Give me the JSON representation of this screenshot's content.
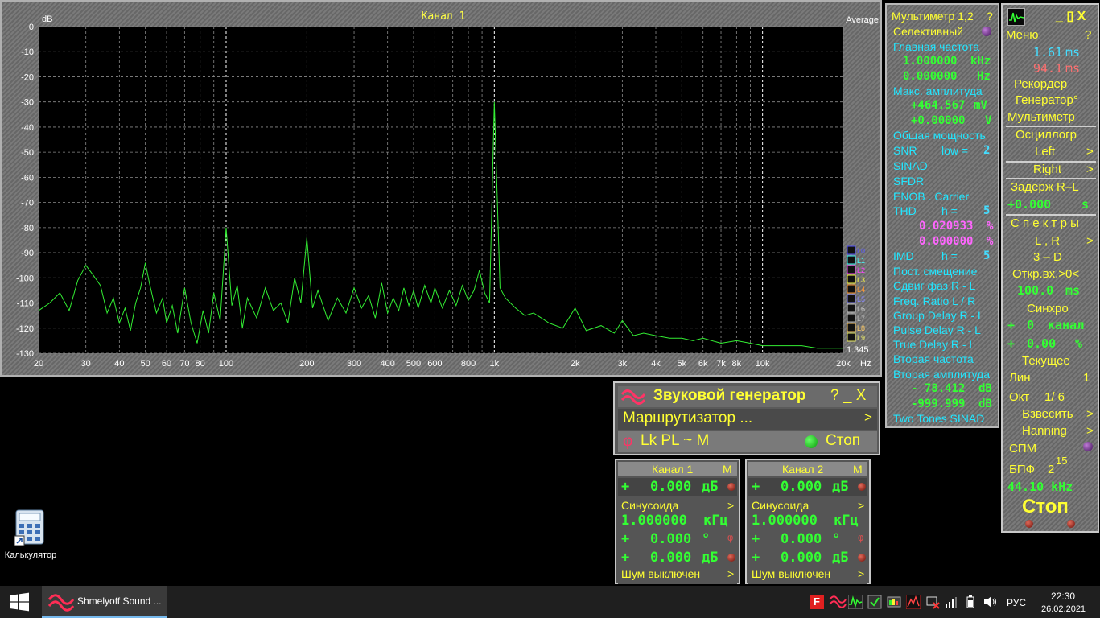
{
  "spectrum": {
    "title": "Канал 1",
    "unit_label": "dB",
    "mode_label": "Average",
    "corner_value": "1.345",
    "hz_label": "Hz",
    "y_ticks": [
      "0",
      "-10",
      "-20",
      "-30",
      "-40",
      "-50",
      "-60",
      "-70",
      "-80",
      "-90",
      "-100",
      "-110",
      "-120",
      "-130"
    ],
    "x_ticks": [
      {
        "f": 20,
        "label": "20"
      },
      {
        "f": 30,
        "label": "30"
      },
      {
        "f": 40,
        "label": "40"
      },
      {
        "f": 50,
        "label": "50"
      },
      {
        "f": 60,
        "label": "60"
      },
      {
        "f": 70,
        "label": "70"
      },
      {
        "f": 80,
        "label": "80"
      },
      {
        "f": 100,
        "label": "100"
      },
      {
        "f": 200,
        "label": "200"
      },
      {
        "f": 300,
        "label": "300"
      },
      {
        "f": 400,
        "label": "400"
      },
      {
        "f": 500,
        "label": "500"
      },
      {
        "f": 600,
        "label": "600"
      },
      {
        "f": 800,
        "label": "800"
      },
      {
        "f": 1000,
        "label": "1k"
      },
      {
        "f": 2000,
        "label": "2k"
      },
      {
        "f": 3000,
        "label": "3k"
      },
      {
        "f": 4000,
        "label": "4k"
      },
      {
        "f": 5000,
        "label": "5k"
      },
      {
        "f": 6000,
        "label": "6k"
      },
      {
        "f": 7000,
        "label": "7k"
      },
      {
        "f": 8000,
        "label": "8k"
      },
      {
        "f": 10000,
        "label": "10k"
      },
      {
        "f": 20000,
        "label": "20k"
      }
    ],
    "layers": [
      {
        "label": "L0",
        "color": "#5555ff"
      },
      {
        "label": "L1",
        "color": "#44ffff"
      },
      {
        "label": "L2",
        "color": "#ff44ff"
      },
      {
        "label": "L3",
        "color": "#ffff44"
      },
      {
        "label": "L4",
        "color": "#ff9933"
      },
      {
        "label": "L5",
        "color": "#8888ff"
      },
      {
        "label": "L6",
        "color": "#cccccc"
      },
      {
        "label": "L7",
        "color": "#bbbbbb"
      },
      {
        "label": "L8",
        "color": "#ffcc66"
      },
      {
        "label": "L9",
        "color": "#eeee66"
      }
    ]
  },
  "chart_data": {
    "type": "line",
    "x_scale": "log",
    "xlim": [
      20,
      20000
    ],
    "ylim": [
      -130,
      0
    ],
    "ylabel": "dB",
    "xlabel": "Hz",
    "series_color": "#33ee33",
    "x": [
      20,
      22,
      24,
      26,
      28,
      30,
      32,
      34,
      36,
      38,
      40,
      42,
      44,
      46,
      48,
      50,
      52,
      55,
      58,
      60,
      63,
      66,
      70,
      74,
      78,
      82,
      86,
      90,
      95,
      100,
      105,
      110,
      115,
      120,
      130,
      140,
      150,
      160,
      170,
      180,
      190,
      200,
      210,
      220,
      240,
      260,
      280,
      300,
      320,
      340,
      360,
      380,
      400,
      420,
      440,
      460,
      480,
      500,
      520,
      550,
      580,
      600,
      640,
      680,
      720,
      760,
      800,
      840,
      880,
      920,
      960,
      1000,
      1050,
      1100,
      1200,
      1300,
      1400,
      1500,
      1600,
      1800,
      2000,
      2200,
      2500,
      2800,
      3000,
      3300,
      3600,
      4000,
      4500,
      5000,
      5500,
      6000,
      7000,
      8000,
      9000,
      10000,
      12000,
      14000,
      16000,
      18000,
      20000
    ],
    "y": [
      -113,
      -110,
      -106,
      -113,
      -101,
      -95,
      -99,
      -103,
      -114,
      -108,
      -118,
      -112,
      -121,
      -110,
      -104,
      -94,
      -103,
      -114,
      -108,
      -118,
      -111,
      -122,
      -104,
      -118,
      -126,
      -113,
      -122,
      -106,
      -117,
      -80,
      -111,
      -103,
      -120,
      -108,
      -116,
      -104,
      -113,
      -110,
      -118,
      -100,
      -110,
      -84,
      -112,
      -105,
      -117,
      -108,
      -114,
      -104,
      -112,
      -107,
      -116,
      -102,
      -114,
      -108,
      -113,
      -104,
      -111,
      -105,
      -112,
      -103,
      -110,
      -104,
      -112,
      -105,
      -111,
      -103,
      -109,
      -105,
      -97,
      -106,
      -110,
      -30,
      -104,
      -108,
      -112,
      -115,
      -114,
      -116,
      -118,
      -120,
      -112,
      -121,
      -119,
      -122,
      -117,
      -123,
      -122,
      -123,
      -124,
      -124,
      -125,
      -124,
      -126,
      -125,
      -126,
      -127,
      -127,
      -127,
      -128,
      -128,
      -128
    ]
  },
  "multimeter": {
    "title": "Мультиметр 1,2",
    "help": "?",
    "selective": "Селективный",
    "main_freq_label": "Главная частота",
    "main_freq_val": "1.000000",
    "main_freq_unit": "kHz",
    "main_freq_val2": "0.000000",
    "main_freq_unit2": "Hz",
    "max_amp_label": "Макс. амплитуда",
    "max_amp_val": "+464.567",
    "max_amp_unit": "mV",
    "max_amp_val2": "+0.00000",
    "max_amp_unit2": "V",
    "total_power": "Общая мощность",
    "snr": "SNR",
    "snr_low": "low =",
    "snr_low_val": "2",
    "sinad": "SINAD",
    "sfdr": "SFDR",
    "enob": "ENOB . Carrier",
    "thd": "THD",
    "thd_h": "h =",
    "thd_h_val": "5",
    "thd_val1": "0.020933",
    "thd_val2": "0.000000",
    "pct": "%",
    "imd": "IMD",
    "imd_h": "h =",
    "imd_h_val": "5",
    "dc_offset": "Пост. смещение",
    "phase_shift": "Сдвиг фаз R - L",
    "freq_ratio": "Freq. Ratio  L / R",
    "group_delay": "Group Delay R - L",
    "pulse_delay": "Pulse Delay R - L",
    "true_delay": "True Delay R - L",
    "second_freq": "Вторая частота",
    "second_amp": "Вторая амплитуда",
    "second_amp_val1": "- 78.412",
    "second_amp_val2": "-999.999",
    "db_unit": "dB",
    "two_tones": "Two Tones SINAD"
  },
  "control": {
    "win_buttons": "_ ▯ X",
    "menu": "Меню",
    "help": "?",
    "time1": "1.61",
    "time2": "94.1",
    "ms": "ms",
    "recorder": "Рекордер",
    "generator": "Генератор°",
    "multimeter": "Мультиметр",
    "oscillograph": "Осциллогр",
    "left": "Left",
    "right": "Right",
    "arrow": ">",
    "delay_label": "Задерж  R–L",
    "delay_val": "+0.000",
    "delay_unit": "s",
    "spectra": "С п е к т р ы",
    "lr": "L , R",
    "three_d": "3 – D",
    "open_input": "Откр.вх.>0<",
    "open_val": "100.0",
    "open_unit": "ms",
    "sync": "Синхро",
    "sync_ch_sign": "+",
    "sync_ch_val": "0",
    "sync_ch_unit": "канал",
    "sync_pct_sign": "+",
    "sync_pct_val": "0.00",
    "sync_pct_unit": "%",
    "current": "Текущее",
    "lin": "Лин",
    "lin_val": "1",
    "oct": "Окт",
    "oct_val": "1/  6",
    "weigh": "Взвесить",
    "hanning": "Hanning",
    "spm": "СПМ",
    "fft": "БПФ",
    "fft_base": "2",
    "fft_exp": "15",
    "sample_rate": "44.10 kHz",
    "stop": "Стоп"
  },
  "generator": {
    "title": "Звуковой генератор",
    "controls": "?  _  X",
    "router": "Маршрутизатор ...",
    "router_arrow": ">",
    "modes": "Lk  PL  ~  M",
    "phi": "φ",
    "stop": "Стоп"
  },
  "channels": [
    {
      "title": "Канал 1",
      "m": "M",
      "level_sign": "+",
      "level_val": "0.000",
      "level_unit": "дБ",
      "waveform": "Синусоида",
      "arrow": ">",
      "freq_val": "1.000000",
      "freq_unit": "кГц",
      "phase_sign": "+",
      "phase_val": "0.000",
      "phase_unit": "°",
      "phi": "φ",
      "amp_sign": "+",
      "amp_val": "0.000",
      "amp_unit": "дБ",
      "noise": "Шум выключен"
    },
    {
      "title": "Канал 2",
      "m": "M",
      "level_sign": "+",
      "level_val": "0.000",
      "level_unit": "дБ",
      "waveform": "Синусоида",
      "arrow": ">",
      "freq_val": "1.000000",
      "freq_unit": "кГц",
      "phase_sign": "+",
      "phase_val": "0.000",
      "phase_unit": "°",
      "phi": "φ",
      "amp_sign": "+",
      "amp_val": "0.000",
      "amp_unit": "дБ",
      "noise": "Шум выключен"
    }
  ],
  "desktop": {
    "calculator_label": "Калькулятор"
  },
  "taskbar": {
    "app_label": "Shmelyoff Sound ...",
    "lang": "РУС",
    "time": "22:30",
    "date": "26.02.2021"
  }
}
